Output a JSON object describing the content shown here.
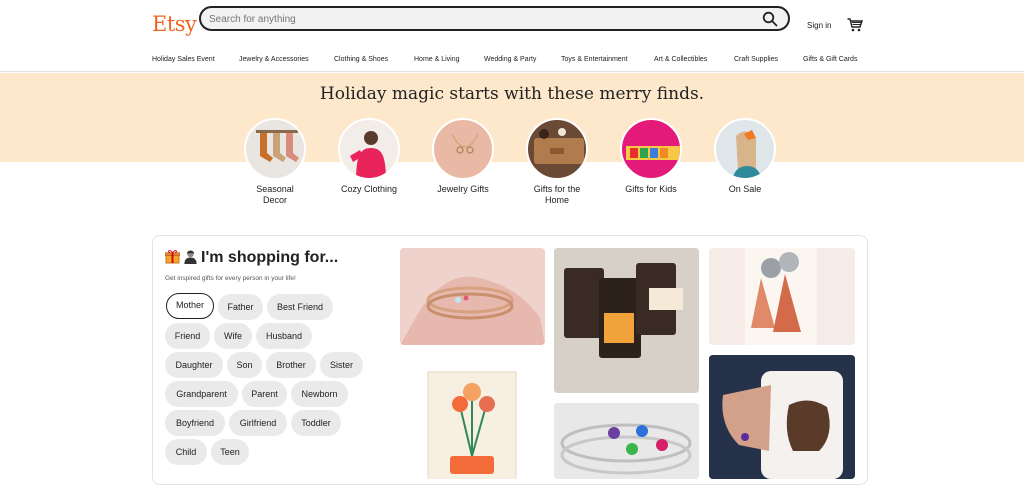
{
  "header": {
    "logo": "Etsy",
    "search_placeholder": "Search for anything",
    "sign_in": "Sign in"
  },
  "nav": {
    "items": [
      "Holiday Sales Event",
      "Jewelry & Accessories",
      "Clothing & Shoes",
      "Home & Living",
      "Wedding & Party",
      "Toys & Entertainment",
      "Art & Collectibles",
      "Craft Supplies",
      "Gifts & Gift Cards"
    ]
  },
  "banner": {
    "headline": "Holiday magic starts with these merry finds.",
    "categories": [
      "Seasonal Decor",
      "Cozy Clothing",
      "Jewelry Gifts",
      "Gifts for the Home",
      "Gifts for Kids",
      "On Sale"
    ]
  },
  "shopping": {
    "title": "I'm shopping for...",
    "subtitle": "Get inspired gifts for every person in your life!",
    "selected": "Mother",
    "people": [
      "Mother",
      "Father",
      "Best Friend",
      "Friend",
      "Wife",
      "Husband",
      "Daughter",
      "Son",
      "Brother",
      "Sister",
      "Grandparent",
      "Parent",
      "Newborn",
      "Boyfriend",
      "Girlfriend",
      "Toddler",
      "Child",
      "Teen"
    ]
  },
  "colors": {
    "brand": "#f1641e",
    "banner_bg": "#fde8cc"
  },
  "icons": [
    "search-icon",
    "cart-icon",
    "gift-icon",
    "person-icon"
  ]
}
